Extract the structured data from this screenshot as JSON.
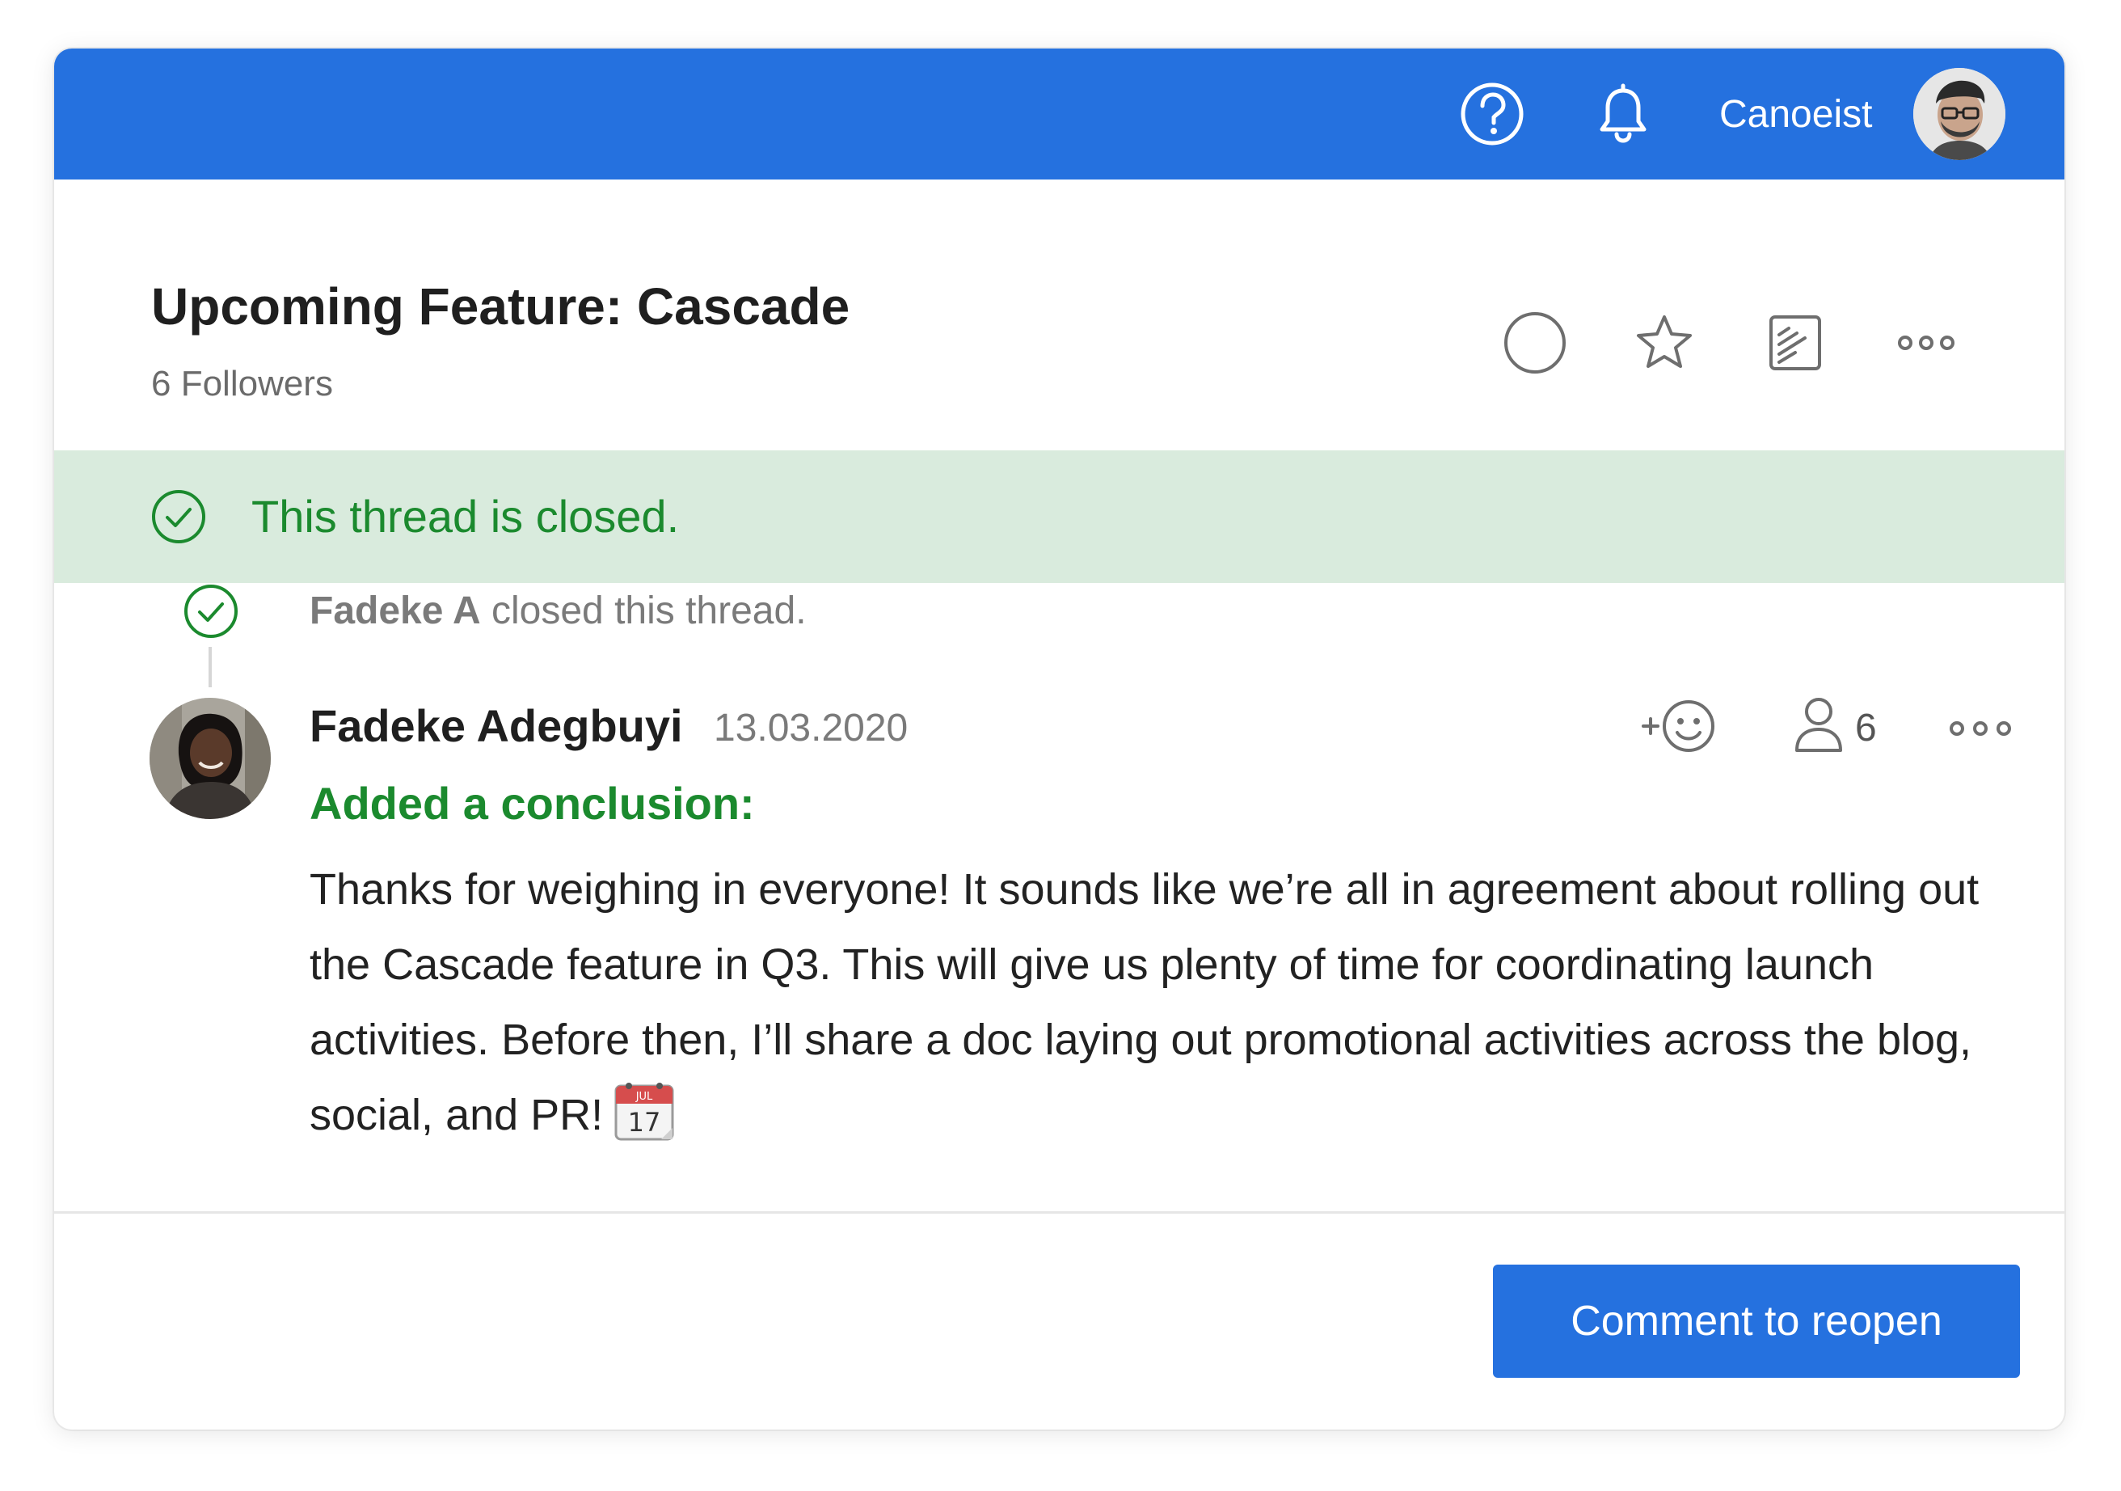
{
  "topbar": {
    "username": "Canoeist",
    "bg_color": "#2571df",
    "icons": [
      "help-icon",
      "bell-icon",
      "avatar"
    ]
  },
  "thread": {
    "title": "Upcoming Feature: Cascade",
    "followers": "6 Followers",
    "header_actions": [
      "circle-icon",
      "star-icon",
      "checklist-icon",
      "more-icon"
    ]
  },
  "banner": {
    "text": "This thread is closed.",
    "color": "#1b8a2e",
    "bg_color": "#d9ebdd"
  },
  "event": {
    "actor": "Fadeke A",
    "action": " closed this thread."
  },
  "comment": {
    "author": "Fadeke Adegbuyi",
    "date": "13.03.2020",
    "label": "Added a conclusion:",
    "body": "Thanks for weighing in everyone! It sounds like we’re all in agreement about rolling out the Cascade feature in Q3. This will give us plenty of time for coordinating launch activities. Before then, I’ll share a doc laying out promotional activities across the blog, social, and PR!",
    "follower_count": "6",
    "actions": [
      "add-reaction-icon",
      "followers-icon",
      "more-icon"
    ],
    "emoji": "calendar-icon",
    "calendar_month": "JUL",
    "calendar_day": "17"
  },
  "footer": {
    "button_label": "Comment to reopen"
  }
}
